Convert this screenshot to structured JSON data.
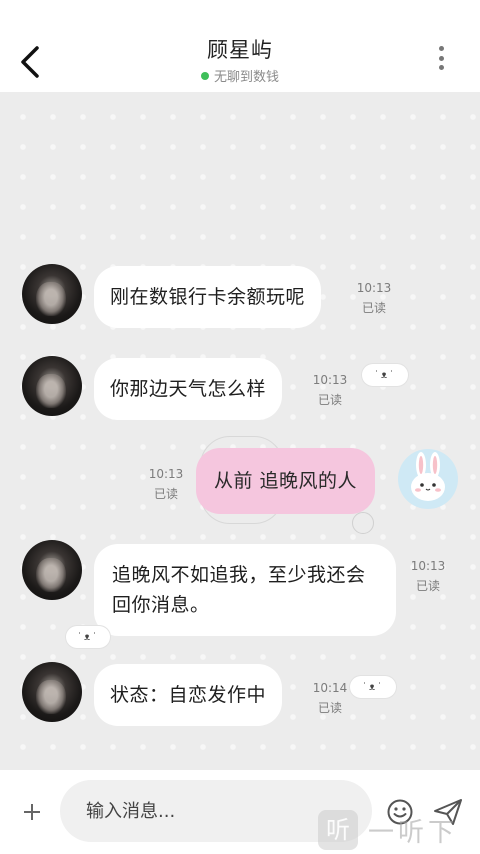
{
  "header": {
    "title": "顾星屿",
    "status": "无聊到数钱",
    "status_color": "#3fbf5a"
  },
  "messages": [
    {
      "side": "left",
      "text": "刚在数银行卡余额玩呢",
      "time": "10:13",
      "read": "已读"
    },
    {
      "side": "left",
      "text": "你那边天气怎么样",
      "time": "10:13",
      "read": "已读"
    },
    {
      "side": "right",
      "text": "从前 追晚风的人",
      "time": "10:13",
      "read": "已读"
    },
    {
      "side": "left",
      "text": "追晚风不如追我，至少我还会回你消息。",
      "time": "10:13",
      "read": "已读"
    },
    {
      "side": "left",
      "text": "状态：自恋发作中",
      "time": "10:14",
      "read": "已读"
    }
  ],
  "input": {
    "placeholder": "输入消息..."
  },
  "colors": {
    "chat_background": "#ececec",
    "my_bubble": "#f5c6de",
    "their_bubble": "#ffffff"
  },
  "icons": [
    "back-arrow-icon",
    "more-dots-icon",
    "plus-icon",
    "emoji-icon",
    "send-icon"
  ],
  "watermark": {
    "glyph": "听",
    "text": "一听下载"
  }
}
